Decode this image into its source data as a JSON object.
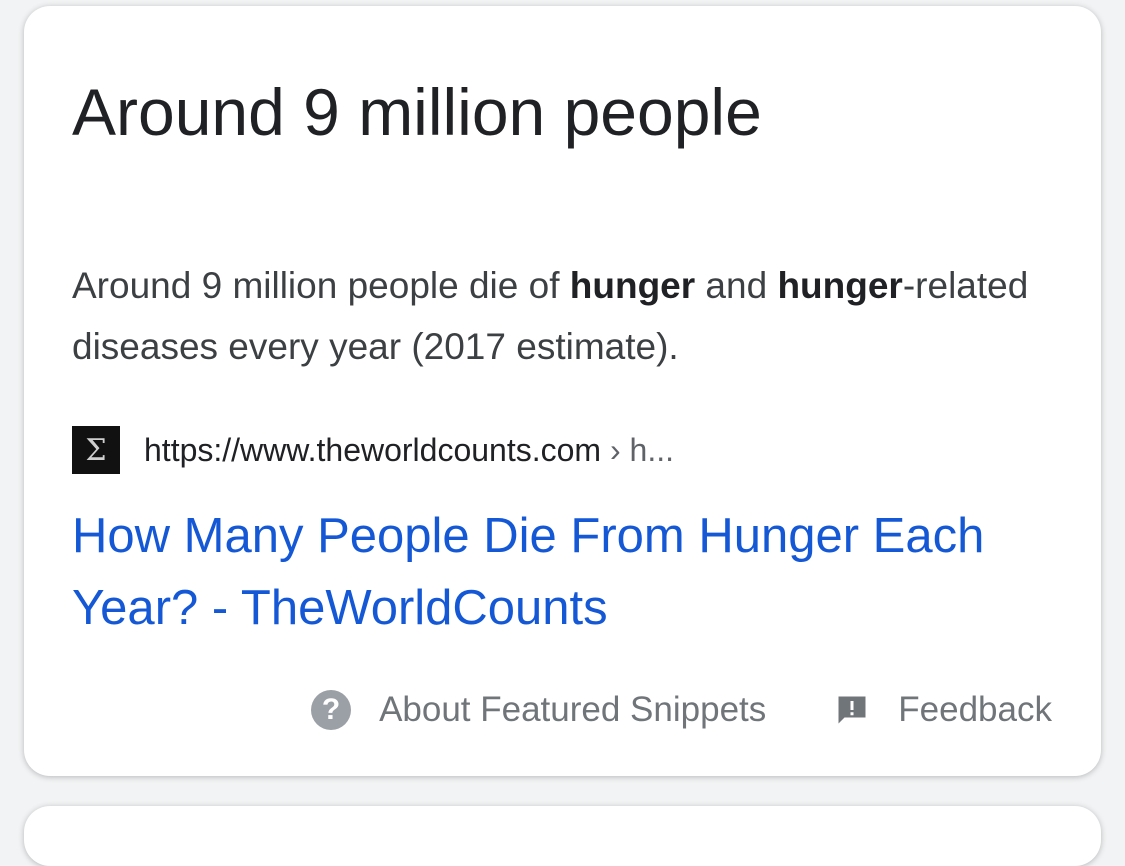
{
  "card": {
    "answer": "Around 9 million people",
    "snippet": {
      "t1": "Around 9 million people die of ",
      "b1": "hunger",
      "t2": " and ",
      "b2": "hunger",
      "t3": "-related diseases every year (2017 estimate)."
    },
    "source": {
      "favicon_glyph": "Σ",
      "domain": "https://www.theworldcounts.com",
      "crumb": " › h..."
    },
    "title_link": "How Many People Die From Hunger Each Year? - TheWorldCounts",
    "footer": {
      "about_label": "About Featured Snippets",
      "about_icon": "help-circle-icon",
      "feedback_label": "Feedback",
      "feedback_icon": "feedback-icon"
    }
  },
  "colors": {
    "link": "#1558d6",
    "text": "#202124",
    "muted": "#70757a"
  }
}
